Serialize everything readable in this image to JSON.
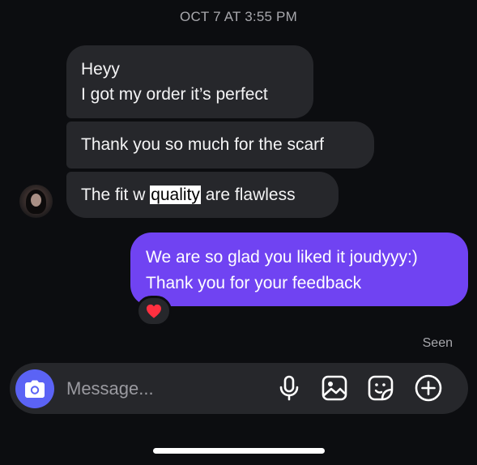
{
  "thread": {
    "timestamp": "OCT 7 AT 3:55 PM",
    "incoming": {
      "msg1_line1": "Heyy",
      "msg1_line2": "I got my order it’s perfect",
      "msg2": "Thank you so much for the scarf",
      "msg3_before": "The fit w ",
      "msg3_highlight": "quality",
      "msg3_after": " are flawless"
    },
    "outgoing": {
      "line1": "We are so glad you liked it joudyyy:)",
      "line2": "Thank you for your feedback",
      "reaction_icon": "red-heart-icon",
      "reaction_color": "#ff3040"
    },
    "seen_label": "Seen"
  },
  "composer": {
    "placeholder": "Message...",
    "camera_icon": "camera-icon",
    "icons": [
      "microphone-icon",
      "photo-gallery-icon",
      "sticker-icon",
      "add-icon"
    ]
  },
  "colors": {
    "background": "#0c0d10",
    "incoming_bubble": "#26272b",
    "outgoing_bubble": "#7043f2",
    "camera_button": "#5b63f5"
  }
}
